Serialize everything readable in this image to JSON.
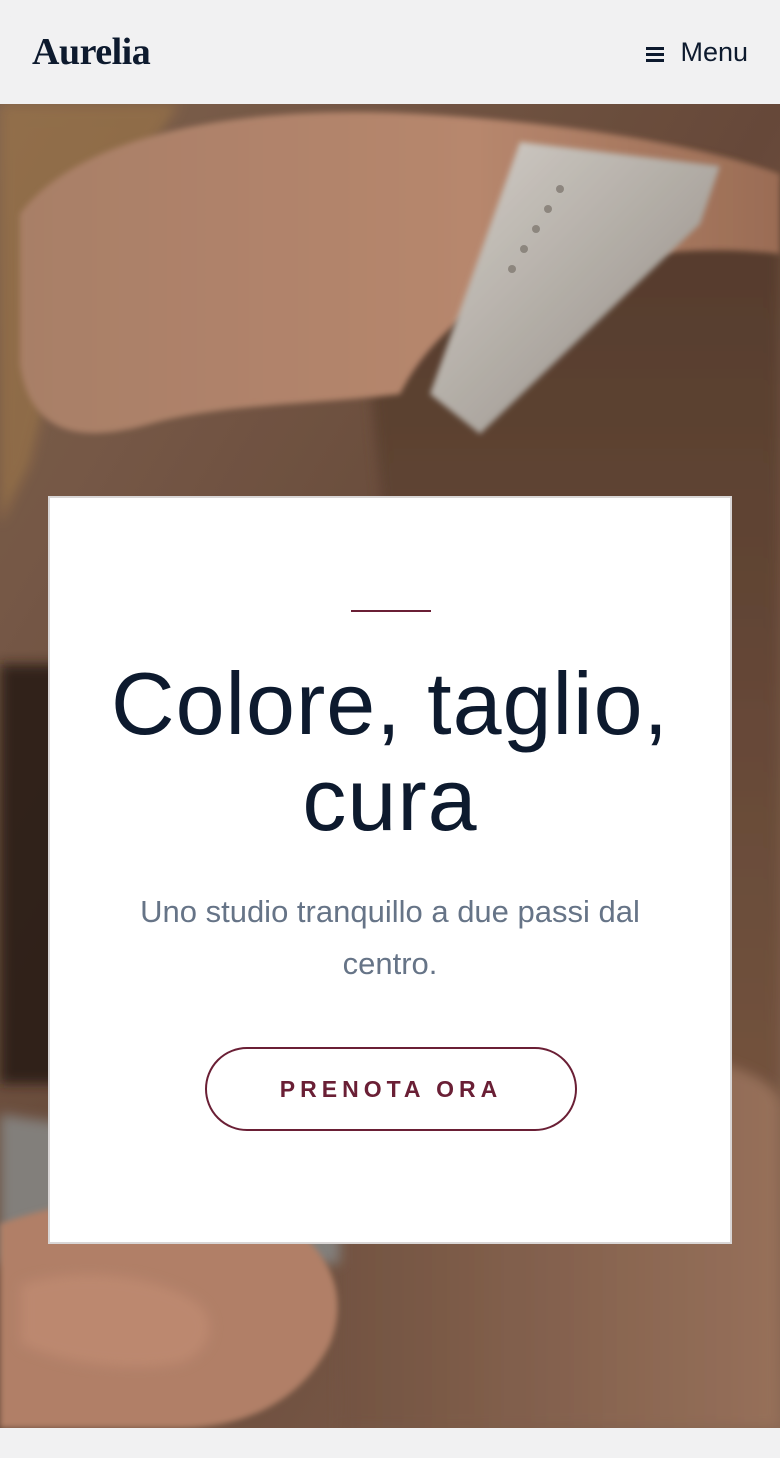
{
  "header": {
    "brand": "Aurelia",
    "menu_label": "Menu",
    "menu_icon": "hamburger-icon"
  },
  "hero": {
    "headline": "Colore, taglio, cura",
    "subtitle": "Uno studio tranquillo a due passi dal centro.",
    "cta_label": "PRENOTA ORA"
  },
  "colors": {
    "accent": "#6a1f35",
    "heading": "#0d1a2e",
    "subtitle": "#667487",
    "page_bg": "#f1f1f2"
  }
}
